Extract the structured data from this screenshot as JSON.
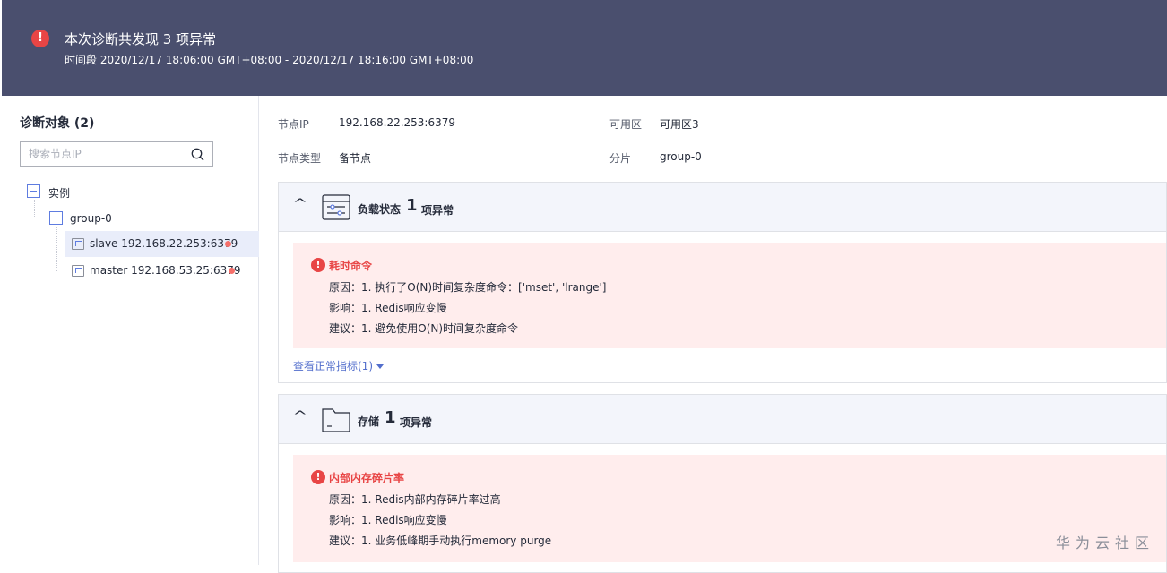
{
  "header": {
    "title": "本次诊断共发现 3 项异常",
    "period": "时间段 2020/12/17 18:06:00 GMT+08:00 - 2020/12/17 18:16:00 GMT+08:00"
  },
  "sidebar": {
    "title": "诊断对象 (2)",
    "search_placeholder": "搜索节点IP",
    "tree": {
      "root_label": "实例",
      "group_label": "group-0",
      "nodes": [
        {
          "label": "slave 192.168.22.253:6379",
          "selected": true
        },
        {
          "label": "master 192.168.53.25:6379",
          "selected": false
        }
      ]
    }
  },
  "node_info": {
    "ip_label": "节点IP",
    "ip_value": "192.168.22.253:6379",
    "zone_label": "可用区",
    "zone_value": "可用区3",
    "type_label": "节点类型",
    "type_value": "备节点",
    "shard_label": "分片",
    "shard_value": "group-0"
  },
  "panels": [
    {
      "name": "负载状态",
      "count": "1",
      "suffix": "项异常",
      "issue": {
        "name": "耗时命令",
        "reason": "原因：1. 执行了O(N)时间复杂度命令：['mset', 'lrange']",
        "impact": "影响：1. Redis响应变慢",
        "advice": "建议：1. 避免使用O(N)时间复杂度命令"
      },
      "more_link": "查看正常指标(1)"
    },
    {
      "name": "存储",
      "count": "1",
      "suffix": "项异常",
      "issue": {
        "name": "内部内存碎片率",
        "reason": "原因：1. Redis内部内存碎片率过高",
        "impact": "影响：1. Redis响应变慢",
        "advice": "建议：1. 业务低峰期手动执行memory purge"
      }
    }
  ],
  "watermark": "华为云社区",
  "colors": {
    "header_bg": "#4a4f6e",
    "alert": "#e84545",
    "issue_bg": "#ffeded",
    "link": "#526ecc",
    "selected_row": "#e9edfa"
  }
}
